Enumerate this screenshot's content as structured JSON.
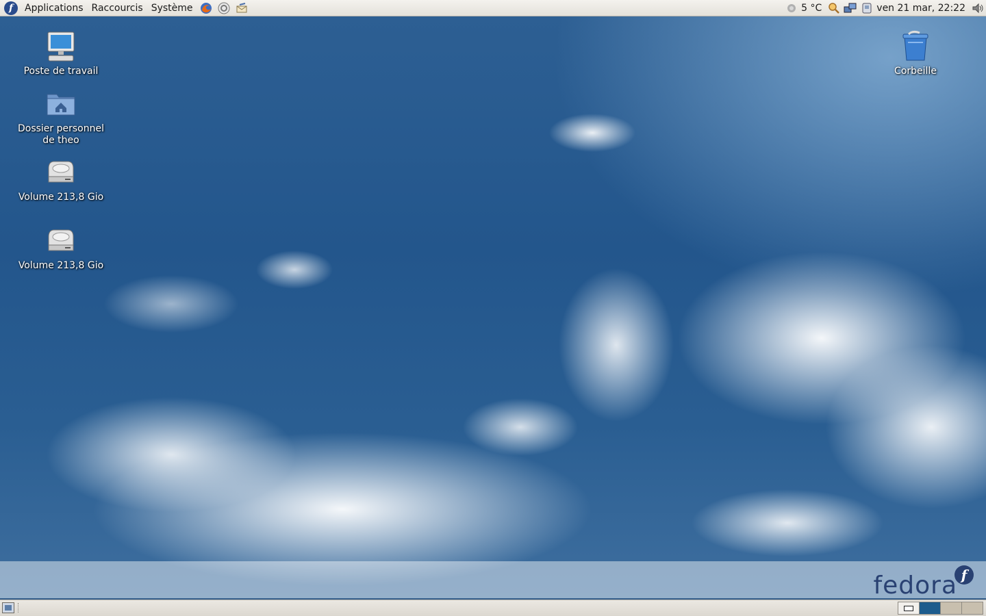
{
  "top_panel": {
    "menus": [
      "Applications",
      "Raccourcis",
      "Système"
    ],
    "launchers": [
      "firefox-icon",
      "help-icon",
      "mail-icon"
    ],
    "weather": "5 °C",
    "clock": "ven 21 mar, 22:22",
    "tray_icons": [
      "weather-icon",
      "search-icon",
      "network-icon",
      "printer-icon",
      "volume-icon"
    ]
  },
  "desktop": {
    "icons": [
      {
        "label": "Poste de travail",
        "icon": "computer-icon"
      },
      {
        "label": "Dossier personnel\nde theo",
        "icon": "home-folder-icon"
      },
      {
        "label": "Volume 213,8 Gio",
        "icon": "harddisk-icon"
      },
      {
        "label": "Volume 213,8 Gio",
        "icon": "harddisk-icon"
      },
      {
        "label": "Corbeille",
        "icon": "trash-icon"
      }
    ],
    "wallpaper_brand": "fedora"
  },
  "bottom_panel": {
    "workspaces": 4,
    "active_workspace": 2
  },
  "colors": {
    "panel_bg": "#e8e5df",
    "brand_blue": "#294172",
    "sky_blue": "#2a5e92"
  }
}
